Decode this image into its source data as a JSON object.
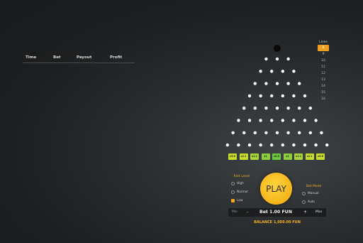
{
  "history": {
    "columns": [
      "Time",
      "Bet",
      "Payout",
      "Profit"
    ]
  },
  "lines": {
    "title": "Lines",
    "options": [
      "8",
      "9",
      "10",
      "11",
      "12",
      "13",
      "14",
      "15",
      "16"
    ],
    "selected": "8"
  },
  "board": {
    "rows": 8,
    "slots": [
      {
        "label": "x5.6",
        "color": "#c8dc2c"
      },
      {
        "label": "x2.1",
        "color": "#c8dc2c"
      },
      {
        "label": "x1.1",
        "color": "#a8d634"
      },
      {
        "label": "x1",
        "color": "#8ccf3a"
      },
      {
        "label": "x0.5",
        "color": "#6fc83e"
      },
      {
        "label": "x1",
        "color": "#8ccf3a"
      },
      {
        "label": "x1.1",
        "color": "#a8d634"
      },
      {
        "label": "x2.1",
        "color": "#c8dc2c"
      },
      {
        "label": "x5.6",
        "color": "#c8dc2c"
      }
    ]
  },
  "risk": {
    "title": "Risk Level",
    "options": [
      "High",
      "Normal",
      "Low"
    ],
    "selected": "Low"
  },
  "play_label": "PLAY",
  "bet_mode": {
    "title": "Bet Mode",
    "options": [
      "Manual",
      "Auto"
    ]
  },
  "bet": {
    "min_label": "Min",
    "minus": "−",
    "value": "Bet 1.00 FUN",
    "plus": "+",
    "max_label": "Max"
  },
  "balance": "BALANCE 1,000.00 FUN",
  "colors": {
    "accent": "#f2a720",
    "slot_green": "#6fc83e",
    "slot_yellow": "#c8dc2c"
  }
}
